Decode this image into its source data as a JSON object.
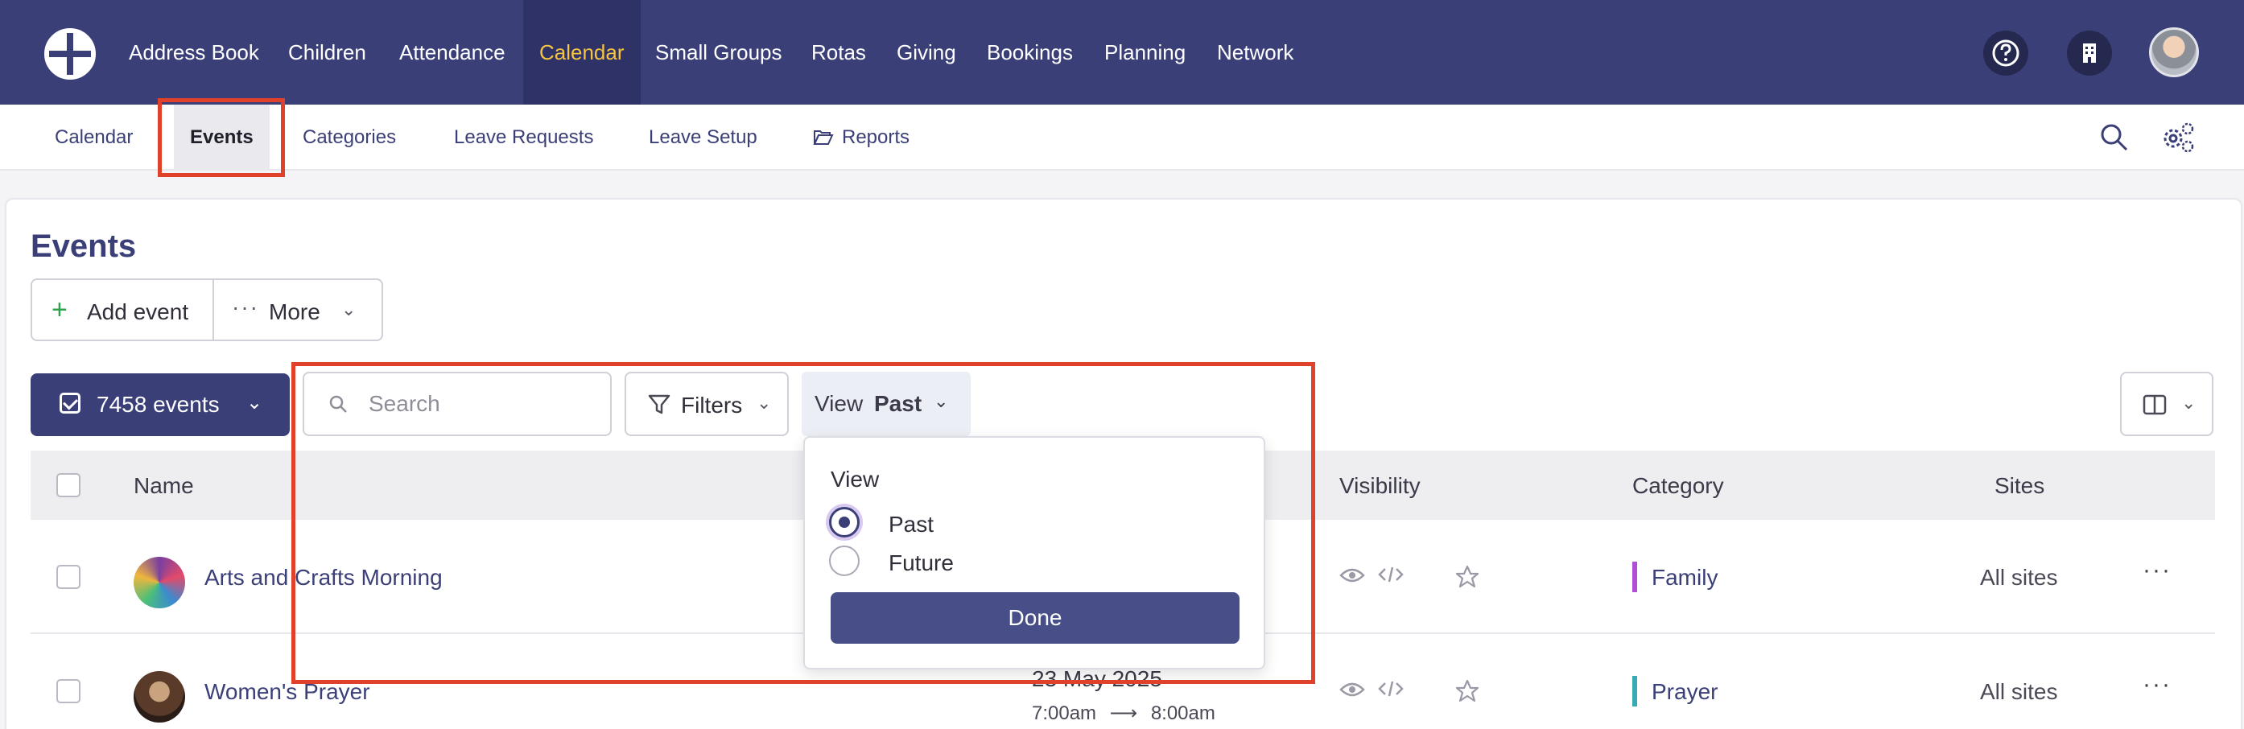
{
  "topnav": {
    "items": [
      "Address Book",
      "Children",
      "Attendance",
      "Calendar",
      "Small Groups",
      "Rotas",
      "Giving",
      "Bookings",
      "Planning",
      "Network"
    ],
    "active": "Calendar"
  },
  "subnav": {
    "items": [
      "Calendar",
      "Events",
      "Categories",
      "Leave Requests",
      "Leave Setup",
      "Reports"
    ],
    "active": "Events"
  },
  "page": {
    "title": "Events",
    "add_event": "Add event",
    "more": "More",
    "events_count": "7458 events",
    "search_placeholder": "Search",
    "filters": "Filters",
    "view_label": "View",
    "view_value": "Past"
  },
  "table": {
    "columns": [
      "Name",
      "Visibility",
      "Category",
      "Sites"
    ],
    "rows": [
      {
        "name": "Arts and Crafts Morning",
        "category": "Family",
        "category_color": "#b04fd3",
        "sites": "All sites",
        "date": "",
        "time_start": "",
        "time_end": ""
      },
      {
        "name": "Women's Prayer",
        "category": "Prayer",
        "category_color": "#3aa9b6",
        "sites": "All sites",
        "date": "23 May 2025",
        "time_start": "7:00am",
        "time_end": "8:00am"
      }
    ]
  },
  "dropdown": {
    "title": "View",
    "options": [
      "Past",
      "Future"
    ],
    "selected": "Past",
    "done": "Done"
  },
  "colors": {
    "nav_bg": "#3b3f78",
    "accent_active": "#f4c542",
    "highlight": "#e0412b"
  }
}
